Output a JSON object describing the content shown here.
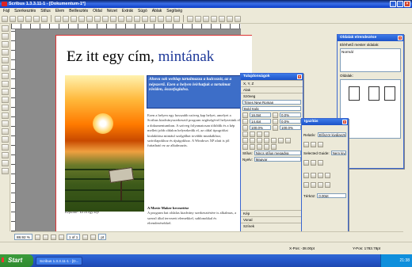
{
  "window": {
    "title": "Scribus 1.3.3.11-1 - [Dokumentum-1*]"
  },
  "menu": [
    "Fájl",
    "Szerkesztés",
    "Stílus",
    "Elem",
    "Beillesztés",
    "Oldal",
    "Nézet",
    "Extrák",
    "Súgó",
    "Ablak",
    "Segítség"
  ],
  "document": {
    "headline_plain": "Ez itt egy cím,",
    "headline_accent": "mintának",
    "intro": "Ahova sok weblap tartalmazza a kulcsszót, az a népszerű. Ezen a helyen leírhatjuk a tartalmat röviden, összefoglalva.",
    "body_top": "Ezen a helyen egy hosszabb szöveg kap helyet, amelyet a Scribus kiadványszerkesztő program segítségével helyeztünk el a dokumentumban. A szöveg folyamatosan töltődik és a kép mellett jobb oldalon helyezkedik el, az oldal tipográfiai kialakítása mintául szolgálhat további munkákhoz, szórólapokhoz és újságokhoz. A Windows XP alatt is jól futtatható ez az alkalmazás.",
    "body_heading": "A Movie Maker bevezetése",
    "body_bottom": "A program hat oldalas kiadvány szerkesztésére is alkalmas, a szerző által tervezett elemekkel, sablonokkal és elrendezésekkel.",
    "caption": "Képaláír: Ez itt egy kép"
  },
  "props": {
    "title": "Tulajdonságok",
    "tab_xyz": "X, Y, Z",
    "tab_shape": "Alak",
    "tab_text": "Szöveg",
    "font": "Times New Roman",
    "style": "Bold Italic",
    "size": "16.0pt",
    "spacing": "14.4pt",
    "scale1": "100.0%",
    "scale2": "100.0%",
    "percent": "0.0%",
    "style_label": "Stílus:",
    "style_value": "Nincs stílus megadva",
    "lang_label": "Nyelv:",
    "lang_value": "Magyar",
    "sec_image": "Kép",
    "sec_line": "Vonal",
    "sec_colors": "Színek"
  },
  "align": {
    "title": "Igazítás",
    "rel_label": "Relatív:",
    "rel_value": "Először kiválasztott",
    "guide_label": "Selected Guide:",
    "guide_value": "Nem kiválasztott",
    "dist_label": "Térköz:",
    "dist_value": "0.00pt"
  },
  "layout": {
    "title": "Oldalak elrendezése",
    "available": "Elérhető mester oldalak:",
    "normal": "Normál",
    "pages_label": "Oldalak:"
  },
  "hbar": {
    "zoom": "88.92 %",
    "page": "1 of 1",
    "unit": "pt"
  },
  "status": {
    "xpos": "X-Pos: -38.00pt",
    "ypos": "Y-Pos: 1783.78pt"
  },
  "taskbar": {
    "start": "Start",
    "task": "Scribus 1.3.3.11-1 - [D...",
    "clock": "21:38"
  }
}
